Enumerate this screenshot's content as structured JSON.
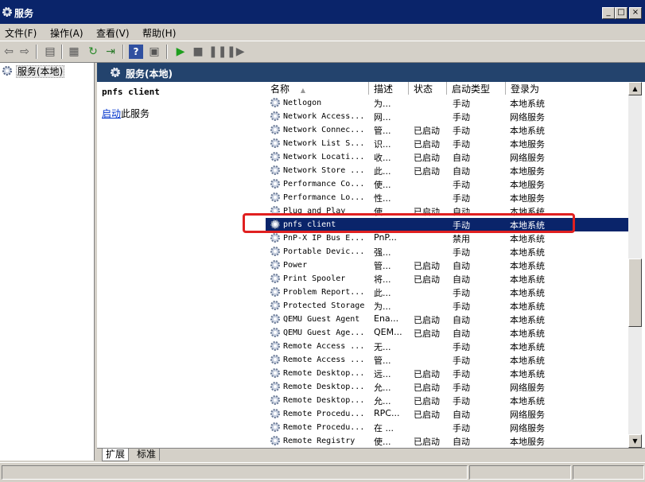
{
  "window": {
    "title": "服务",
    "min_label": "_",
    "max_label": "□",
    "close_label": "×"
  },
  "menu": [
    "文件(F)",
    "操作(A)",
    "查看(V)",
    "帮助(H)"
  ],
  "toolbar": {
    "icons": [
      "back-icon",
      "forward-icon",
      "show-tree-icon",
      "properties-icon",
      "refresh-icon",
      "export-icon",
      "help-icon",
      "view-icon",
      "start-icon",
      "stop-icon",
      "pause-icon",
      "resume-icon"
    ]
  },
  "tree": {
    "root_label": "服务(本地)"
  },
  "header": {
    "title": "服务(本地)"
  },
  "description": {
    "service_name": "pnfs client",
    "start_link": "启动",
    "start_suffix": "此服务"
  },
  "columns": [
    "名称",
    "描述",
    "状态",
    "启动类型",
    "登录为"
  ],
  "sort_indicator": "▲",
  "services": [
    {
      "name": "Netlogon",
      "desc": "为...",
      "status": "",
      "startup": "手动",
      "logon": "本地系统"
    },
    {
      "name": "Network Access...",
      "desc": "网...",
      "status": "",
      "startup": "手动",
      "logon": "网络服务"
    },
    {
      "name": "Network Connec...",
      "desc": "管...",
      "status": "已启动",
      "startup": "手动",
      "logon": "本地系统"
    },
    {
      "name": "Network List S...",
      "desc": "识...",
      "status": "已启动",
      "startup": "手动",
      "logon": "本地服务"
    },
    {
      "name": "Network Locati...",
      "desc": "收...",
      "status": "已启动",
      "startup": "自动",
      "logon": "网络服务"
    },
    {
      "name": "Network Store ...",
      "desc": "此...",
      "status": "已启动",
      "startup": "自动",
      "logon": "本地服务"
    },
    {
      "name": "Performance Co...",
      "desc": "使...",
      "status": "",
      "startup": "手动",
      "logon": "本地服务"
    },
    {
      "name": "Performance Lo...",
      "desc": "性...",
      "status": "",
      "startup": "手动",
      "logon": "本地服务"
    },
    {
      "name": "Plug and Play",
      "desc": "使...",
      "status": "已启动",
      "startup": "自动",
      "logon": "本地系统"
    },
    {
      "name": "pnfs client",
      "desc": "",
      "status": "",
      "startup": "手动",
      "logon": "本地系统"
    },
    {
      "name": "PnP-X IP Bus E...",
      "desc": "PnP...",
      "status": "",
      "startup": "禁用",
      "logon": "本地系统"
    },
    {
      "name": "Portable Devic...",
      "desc": "强...",
      "status": "",
      "startup": "手动",
      "logon": "本地系统"
    },
    {
      "name": "Power",
      "desc": "管...",
      "status": "已启动",
      "startup": "自动",
      "logon": "本地系统"
    },
    {
      "name": "Print Spooler",
      "desc": "将...",
      "status": "已启动",
      "startup": "自动",
      "logon": "本地系统"
    },
    {
      "name": "Problem Report...",
      "desc": "此...",
      "status": "",
      "startup": "手动",
      "logon": "本地系统"
    },
    {
      "name": "Protected Storage",
      "desc": "为...",
      "status": "",
      "startup": "手动",
      "logon": "本地系统"
    },
    {
      "name": "QEMU Guest Agent",
      "desc": "Ena...",
      "status": "已启动",
      "startup": "自动",
      "logon": "本地系统"
    },
    {
      "name": "QEMU Guest Age...",
      "desc": "QEM...",
      "status": "已启动",
      "startup": "自动",
      "logon": "本地系统"
    },
    {
      "name": "Remote Access ...",
      "desc": "无...",
      "status": "",
      "startup": "手动",
      "logon": "本地系统"
    },
    {
      "name": "Remote Access ...",
      "desc": "管...",
      "status": "",
      "startup": "手动",
      "logon": "本地系统"
    },
    {
      "name": "Remote Desktop...",
      "desc": "远...",
      "status": "已启动",
      "startup": "手动",
      "logon": "本地系统"
    },
    {
      "name": "Remote Desktop...",
      "desc": "允...",
      "status": "已启动",
      "startup": "手动",
      "logon": "网络服务"
    },
    {
      "name": "Remote Desktop...",
      "desc": "允...",
      "status": "已启动",
      "startup": "手动",
      "logon": "本地系统"
    },
    {
      "name": "Remote Procedu...",
      "desc": "RPC...",
      "status": "已启动",
      "startup": "自动",
      "logon": "网络服务"
    },
    {
      "name": "Remote Procedu...",
      "desc": "在 ...",
      "status": "",
      "startup": "手动",
      "logon": "网络服务"
    },
    {
      "name": "Remote Registry",
      "desc": "使...",
      "status": "已启动",
      "startup": "自动",
      "logon": "本地服务"
    }
  ],
  "selected_index": 9,
  "tabs": [
    "扩展",
    "标准"
  ]
}
